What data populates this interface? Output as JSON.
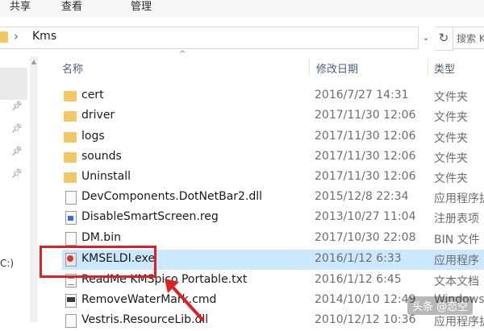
{
  "ribbon": {
    "tabs": [
      "共享",
      "查看",
      "管理"
    ]
  },
  "address": {
    "path": "Kms",
    "search_placeholder": "搜索 Kms"
  },
  "nav": {
    "drive_label": "C:)"
  },
  "columns": {
    "name": "名称",
    "date": "修改日期",
    "type": "类型"
  },
  "files": [
    {
      "name": "cert",
      "date": "2016/7/27 14:31",
      "type": "文件夹",
      "icon": "folder-icon"
    },
    {
      "name": "driver",
      "date": "2017/11/30 12:06",
      "type": "文件夹",
      "icon": "folder-icon"
    },
    {
      "name": "logs",
      "date": "2017/11/30 12:06",
      "type": "文件夹",
      "icon": "folder-icon"
    },
    {
      "name": "sounds",
      "date": "2017/11/30 12:06",
      "type": "文件夹",
      "icon": "folder-icon"
    },
    {
      "name": "Uninstall",
      "date": "2017/11/30 12:06",
      "type": "文件夹",
      "icon": "folder-icon"
    },
    {
      "name": "DevComponents.DotNetBar2.dll",
      "date": "2015/12/8 22:34",
      "type": "应用程序扩",
      "icon": "dll-file-icon"
    },
    {
      "name": "DisableSmartScreen.reg",
      "date": "2013/10/27 11:04",
      "type": "注册表项",
      "icon": "registry-file-icon"
    },
    {
      "name": "DM.bin",
      "date": "2017/10/30 22:08",
      "type": "BIN 文件",
      "icon": "bin-file-icon"
    },
    {
      "name": "KMSELDI.exe",
      "date": "2016/1/12 6:33",
      "type": "应用程序",
      "icon": "exe-app-icon"
    },
    {
      "name": "ReadMe KMSpico Portable.txt",
      "date": "2016/1/12 6:45",
      "type": "文本文档",
      "icon": "text-file-icon"
    },
    {
      "name": "RemoveWaterMark.cmd",
      "date": "2014/10/10 12:49",
      "type": "Windows",
      "icon": "cmd-file-icon"
    },
    {
      "name": "Vestris.ResourceLib.dll",
      "date": "2010/12/12 10:36",
      "type": "应用程序扩",
      "icon": "dll-file-icon"
    }
  ],
  "selected_file": "KMSELDI.exe",
  "watermark": "头条 @恋空",
  "colors": {
    "selection": "#cce8ff",
    "highlight_box": "#e02020",
    "folder": "#f3c862"
  }
}
